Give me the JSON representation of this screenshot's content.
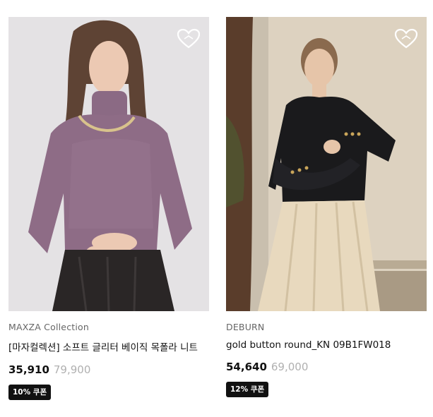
{
  "products": [
    {
      "brand": "MAXZA Collection",
      "title": "[마자컬렉션] 소프트 글리터 베이직 목폴라 니트",
      "sale_price": "35,910",
      "original_price": "79,900",
      "coupon": "10% 쿠폰",
      "wishlist_icon": "heart-outline-icon"
    },
    {
      "brand": "DEBURN",
      "title": "gold button round_KN 09B1FW018",
      "sale_price": "54,640",
      "original_price": "69,000",
      "coupon": "12% 쿠폰",
      "wishlist_icon": "heart-outline-icon"
    }
  ]
}
